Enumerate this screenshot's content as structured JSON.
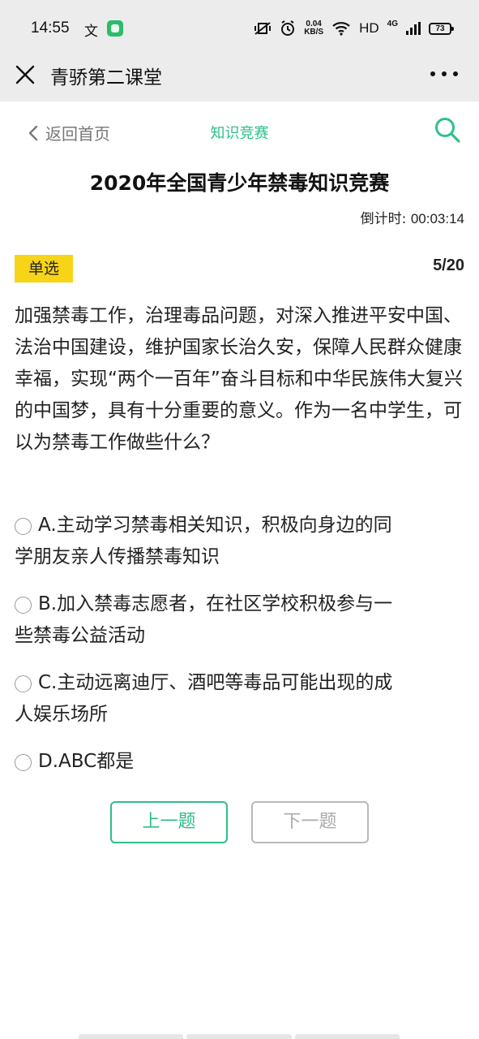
{
  "status_bar": {
    "time": "14:55",
    "lang_icon": "文",
    "speed_value": "0.04",
    "speed_unit": "KB/S",
    "hd": "HD",
    "network": "4G",
    "battery": "73"
  },
  "title_bar": {
    "title": "青骄第二课堂"
  },
  "nav": {
    "back_label": "返回首页",
    "title": "知识竞赛"
  },
  "quiz": {
    "title": "2020年全国青少年禁毒知识竞赛",
    "countdown_label": "倒计时: ",
    "countdown_value": "00:03:14",
    "question_type": "单选",
    "progress": "5/20",
    "question": "加强禁毒工作，治理毒品问题，对深入推进平安中国、法治中国建设，维护国家长治久安，保障人民群众健康幸福，实现“两个一百年”奋斗目标和中华民族伟大复兴的中国梦，具有十分重要的意义。作为一名中学生，可以为禁毒工作做些什么？",
    "options": [
      {
        "line1": "A.主动学习禁毒相关知识，积极向身边的同",
        "line2": "学朋友亲人传播禁毒知识"
      },
      {
        "line1": "B.加入禁毒志愿者，在社区学校积极参与一",
        "line2": "些禁毒公益活动"
      },
      {
        "line1": "C.主动远离迪厅、酒吧等毒品可能出现的成",
        "line2": "人娱乐场所"
      },
      {
        "line1": "D.ABC都是",
        "line2": ""
      }
    ],
    "prev_label": "上一题",
    "next_label": "下一题"
  },
  "colors": {
    "accent": "#2fbe86",
    "badge": "#f7d417",
    "disabled": "#b9b9b9"
  }
}
